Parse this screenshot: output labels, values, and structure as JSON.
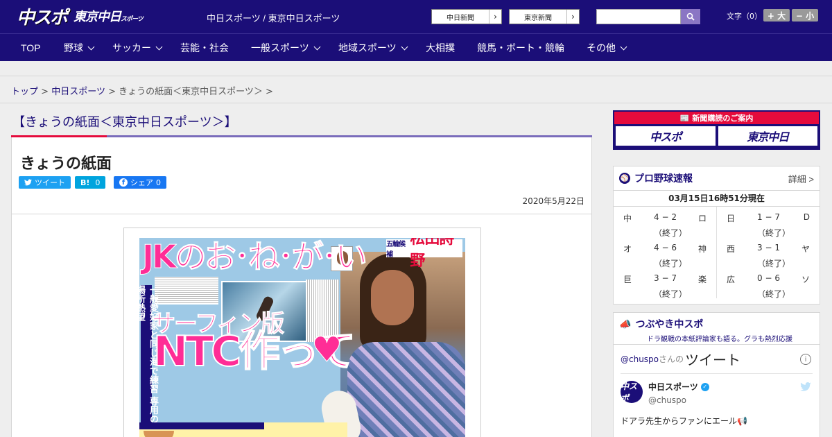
{
  "header": {
    "logo_main": "中スポ",
    "logo_sub": "東京中日",
    "logo_sub_small": "スポーツ",
    "tagline": "中日スポーツ / 東京中日スポーツ",
    "link_buttons": [
      {
        "label": "中日新聞"
      },
      {
        "label": "東京新聞"
      }
    ],
    "search": {
      "placeholder": ""
    },
    "font_label": "文字（0）",
    "font_larger": "+ 大",
    "font_smaller": "− 小"
  },
  "nav": {
    "items": [
      {
        "label": "TOP",
        "dropdown": false
      },
      {
        "label": "野球",
        "dropdown": true
      },
      {
        "label": "サッカー",
        "dropdown": true
      },
      {
        "label": "芸能・社会",
        "dropdown": false
      },
      {
        "label": "一般スポーツ",
        "dropdown": true
      },
      {
        "label": "地域スポーツ",
        "dropdown": true
      },
      {
        "label": "大相撲",
        "dropdown": false
      },
      {
        "label": "競馬・ボート・競輪",
        "dropdown": false
      },
      {
        "label": "その他",
        "dropdown": true
      }
    ]
  },
  "breadcrumb": {
    "items": [
      "トップ",
      "中日スポーツ"
    ],
    "current": "きょうの紙面＜東京中日スポーツ＞",
    "sep": ">"
  },
  "page": {
    "heading": "【きょうの紙面＜東京中日スポーツ＞】",
    "title": "きょうの紙面",
    "date": "2020年5月22日",
    "share": {
      "tweet": "ツイート",
      "hatena": "B!",
      "hatena_count": "0",
      "fb": "シェア",
      "fb_count": "0"
    }
  },
  "paper_image": {
    "headline": "JKのお･ね･が･い",
    "name_prefix": "五輪候補",
    "name": "松田詩野",
    "sub": "サーフィン版",
    "main": "NTC作って",
    "heart": "♥",
    "vertical": "一般愛好家と同じ海で練習 専用の場所熱望"
  },
  "sidebar": {
    "subscription": {
      "title": "新聞購読のご案内",
      "logo1": "中スポ",
      "logo2": "東京中日"
    },
    "baseball": {
      "title": "プロ野球速報",
      "more": "詳細 >",
      "updated": "03月15日16時51分現在",
      "games": [
        [
          {
            "home": "中",
            "score": "4 − 2",
            "away": "ロ",
            "status": "（終了）"
          },
          {
            "home": "オ",
            "score": "4 − 6",
            "away": "神",
            "status": "（終了）"
          },
          {
            "home": "巨",
            "score": "3 − 7",
            "away": "楽",
            "status": "（終了）"
          }
        ],
        [
          {
            "home": "日",
            "score": "1 − 7",
            "away": "D",
            "status": "（終了）"
          },
          {
            "home": "西",
            "score": "3 − 1",
            "away": "ヤ",
            "status": "（終了）"
          },
          {
            "home": "広",
            "score": "0 − 6",
            "away": "ソ",
            "status": "（終了）"
          }
        ]
      ]
    },
    "tweets": {
      "title": "つぶやき中スポ",
      "description": "ドラ観戦の本紙評論家も語る。グラも熱烈応援",
      "account": "@chuspo",
      "account_suffix": "さんの",
      "big_label": "ツイート",
      "info": "i",
      "tweet": {
        "avatar": "中スポ",
        "name": "中日スポーツ",
        "handle": "@chuspo",
        "text": "ドアラ先生からファンにエール📢"
      }
    }
  },
  "colors": {
    "brand_navy": "#1b0e78",
    "accent_red": "#e50b3c",
    "accent_purple": "#7a6cbb",
    "twitter_blue": "#1da1f2"
  }
}
